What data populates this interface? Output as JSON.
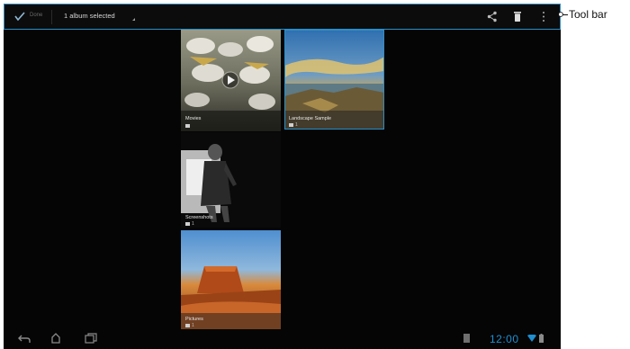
{
  "toolbar": {
    "done_label": "Done",
    "selection_label": "1 album selected",
    "actions": [
      "share-icon",
      "delete-icon",
      "overflow-menu-icon"
    ]
  },
  "annotation": {
    "label": "Tool bar"
  },
  "albums": [
    {
      "name": "Movies",
      "count": ""
    },
    {
      "name": "Landscape Sample",
      "count": "1"
    },
    {
      "name": "Screenshots",
      "count": "1"
    },
    {
      "name": "Pictures",
      "count": "1"
    }
  ],
  "status_bar": {
    "time": "12:00"
  },
  "colors": {
    "accent": "#2a8fc8",
    "background": "#050505",
    "clock": "#1f8fd0"
  }
}
